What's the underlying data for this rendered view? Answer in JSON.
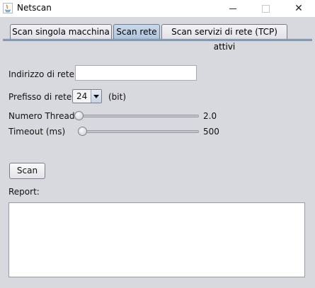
{
  "window": {
    "title": "Netscan",
    "minimize_icon": "minimize-icon",
    "maximize_icon": "maximize-icon",
    "close_icon": "close-icon",
    "close_glyph": "✕"
  },
  "tabs": [
    {
      "label": "Scan singola macchina",
      "active": false
    },
    {
      "label": "Scan rete",
      "active": true
    },
    {
      "label": "Scan servizi di rete (TCP) attivi",
      "active": false
    }
  ],
  "form": {
    "network_address_label": "Indirizzo di rete",
    "network_address_value": "",
    "prefix_label": "Prefisso di rete",
    "prefix_value": "24",
    "prefix_unit": "(bit)",
    "threads_label": "Numero Thread",
    "threads_value": "2.0",
    "timeout_label": "Timeout (ms)",
    "timeout_value": "500"
  },
  "actions": {
    "scan_label": "Scan"
  },
  "report": {
    "label": "Report:",
    "content": ""
  }
}
